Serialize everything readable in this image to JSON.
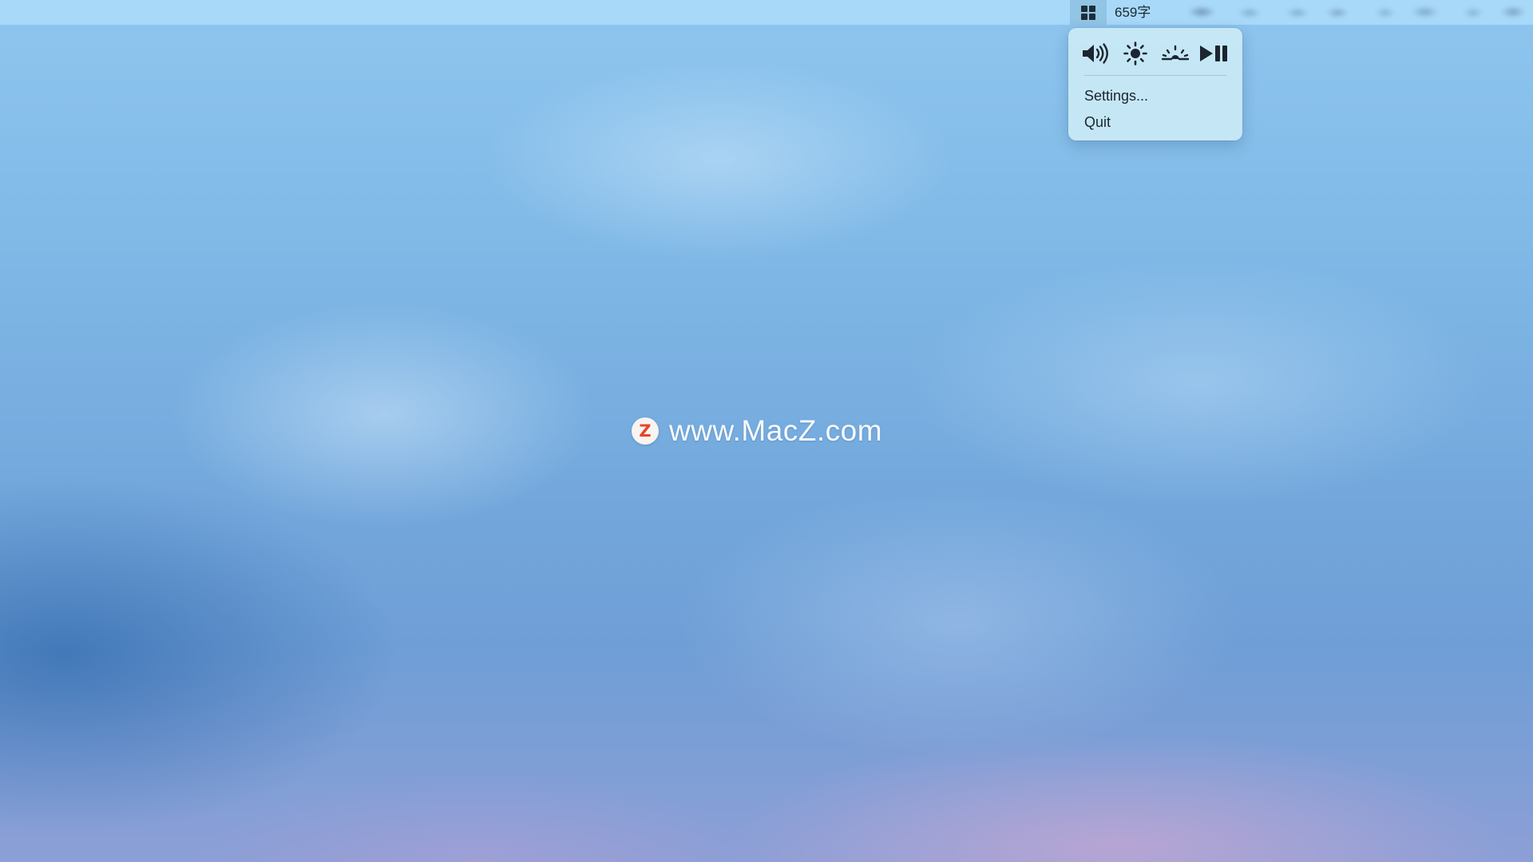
{
  "menubar": {
    "app_icon": "grid-icon",
    "word_count": "659字"
  },
  "popover": {
    "controls": [
      {
        "icon": "volume-icon"
      },
      {
        "icon": "brightness-icon"
      },
      {
        "icon": "dim-brightness-icon"
      },
      {
        "icon": "play-pause-icon"
      }
    ],
    "menu_items": [
      {
        "label": "Settings..."
      },
      {
        "label": "Quit"
      }
    ]
  },
  "watermark": {
    "text": "www.MacZ.com",
    "logo_letter": "Z",
    "logo_color": "#e8452a"
  },
  "colors": {
    "menubar_bg": "#aadafa",
    "popover_bg": "#c8e8f5",
    "icon_color": "#1c2530"
  }
}
